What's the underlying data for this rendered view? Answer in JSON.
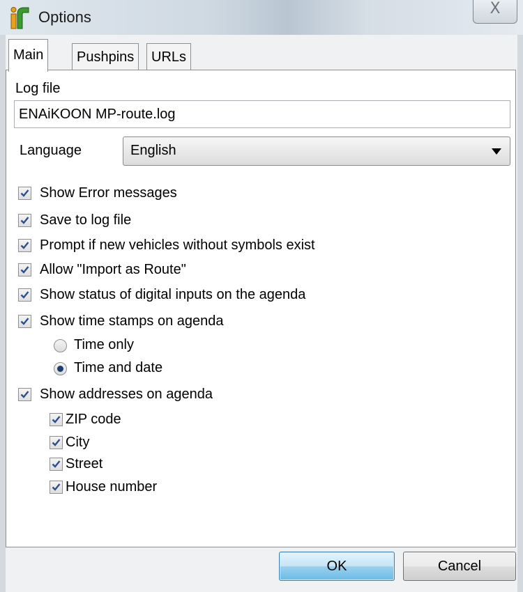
{
  "window": {
    "title": "Options",
    "close_glyph": "X",
    "app_icon": "app-logo-icon"
  },
  "tabs": [
    {
      "label": "Main",
      "active": true
    },
    {
      "label": "Pushpins",
      "active": false
    },
    {
      "label": "URLs",
      "active": false
    }
  ],
  "main": {
    "logfile_label": "Log file",
    "logfile_value": "ENAiKOON MP-route.log",
    "language_label": "Language",
    "language_value": "English",
    "checkboxes": [
      {
        "label": "Show Error messages",
        "checked": true
      },
      {
        "label": "Save to log file",
        "checked": true
      },
      {
        "label": "Prompt if new vehicles without symbols exist",
        "checked": true
      },
      {
        "label": "Allow \"Import as Route\"",
        "checked": true
      },
      {
        "label": "Show status of digital inputs on the agenda",
        "checked": true
      },
      {
        "label": "Show time stamps on agenda",
        "checked": true
      }
    ],
    "timestamp_options": [
      {
        "label": "Time only",
        "selected": false
      },
      {
        "label": "Time and date",
        "selected": true
      }
    ],
    "addresses": {
      "label": "Show addresses on agenda",
      "checked": true
    },
    "address_fields": [
      {
        "label": "ZIP code",
        "checked": true
      },
      {
        "label": "City",
        "checked": true
      },
      {
        "label": "Street",
        "checked": true
      },
      {
        "label": "House number",
        "checked": true
      }
    ]
  },
  "buttons": {
    "ok": "OK",
    "cancel": "Cancel"
  },
  "colors": {
    "check": "#2a4f8c",
    "default_button": "#6bbbe6"
  }
}
